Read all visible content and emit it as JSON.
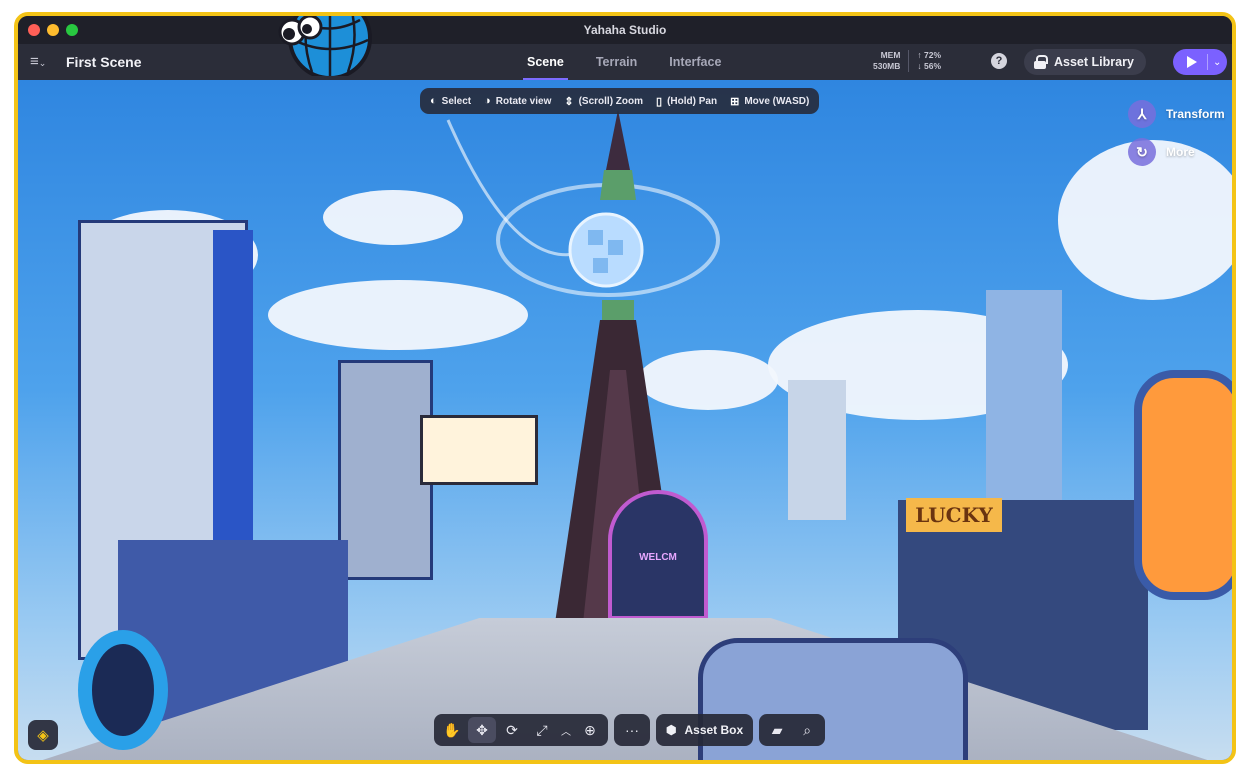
{
  "window": {
    "title": "Yahaha Studio"
  },
  "toolbar": {
    "scene_name": "First Scene",
    "tabs": [
      {
        "label": "Scene",
        "active": true
      },
      {
        "label": "Terrain",
        "active": false
      },
      {
        "label": "Interface",
        "active": false
      }
    ],
    "stats": {
      "mem_label": "MEM",
      "mem_value": "530MB",
      "up_value": "72%",
      "down_value": "56%"
    },
    "asset_library_label": "Asset Library"
  },
  "hints": [
    {
      "icon": "mouse-left-icon",
      "label": "Select"
    },
    {
      "icon": "mouse-right-icon",
      "label": "Rotate view"
    },
    {
      "icon": "mouse-scroll-icon",
      "label": "(Scroll) Zoom"
    },
    {
      "icon": "mouse-middle-icon",
      "label": "(Hold) Pan"
    },
    {
      "icon": "keys-icon",
      "label": "Move (WASD)"
    }
  ],
  "right_tools": [
    {
      "icon": "transform-icon",
      "label": "Transform"
    },
    {
      "icon": "more-icon",
      "label": "More"
    }
  ],
  "bottom_toolbar": {
    "asset_box_label": "Asset Box"
  },
  "scene_signs": {
    "lucky": "LUCKY",
    "welcome": "WELCM"
  },
  "colors": {
    "frame": "#f3c316",
    "accent": "#7b61ff",
    "toolbar_bg": "#2b2d39"
  }
}
